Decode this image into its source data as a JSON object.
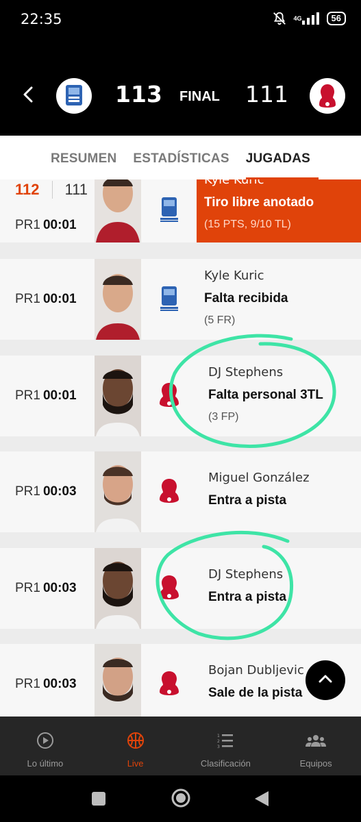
{
  "status": {
    "time": "22:35",
    "network": "4G",
    "battery": "56"
  },
  "header": {
    "home_score": "113",
    "state": "FINAL",
    "away_score": "111"
  },
  "tabs": [
    {
      "label": "RESUMEN"
    },
    {
      "label": "ESTADÍSTICAS"
    },
    {
      "label": "JUGADAS"
    }
  ],
  "plays": [
    {
      "score_home": "112",
      "score_away": "111",
      "period": "PR1",
      "clock": "00:01",
      "player": "Kyle Kuric",
      "action": "Tiro libre anotado",
      "detail": "(15 PTS, 9/10 TL)"
    },
    {
      "period": "PR1",
      "clock": "00:01",
      "player": "Kyle Kuric",
      "action": "Falta recibida",
      "detail": "(5 FR)"
    },
    {
      "period": "PR1",
      "clock": "00:01",
      "player": "DJ Stephens",
      "action": "Falta personal 3TL",
      "detail": "(3 FP)"
    },
    {
      "period": "PR1",
      "clock": "00:03",
      "player": "Miguel González",
      "action": "Entra a pista",
      "detail": ""
    },
    {
      "period": "PR1",
      "clock": "00:03",
      "player": "DJ Stephens",
      "action": "Entra a pista",
      "detail": ""
    },
    {
      "period": "PR1",
      "clock": "00:03",
      "player": "Bojan Dubljevic",
      "action": "Sale de la pista",
      "detail": ""
    }
  ],
  "bottom_nav": [
    {
      "label": "Lo último",
      "icon": "play-circle-icon"
    },
    {
      "label": "Live",
      "icon": "basketball-icon"
    },
    {
      "label": "Clasificación",
      "icon": "ranking-list-icon"
    },
    {
      "label": "Equipos",
      "icon": "people-group-icon"
    }
  ],
  "colors": {
    "accent": "#e0430a",
    "annotation": "#3ee4a6",
    "header_bg": "#000000"
  }
}
